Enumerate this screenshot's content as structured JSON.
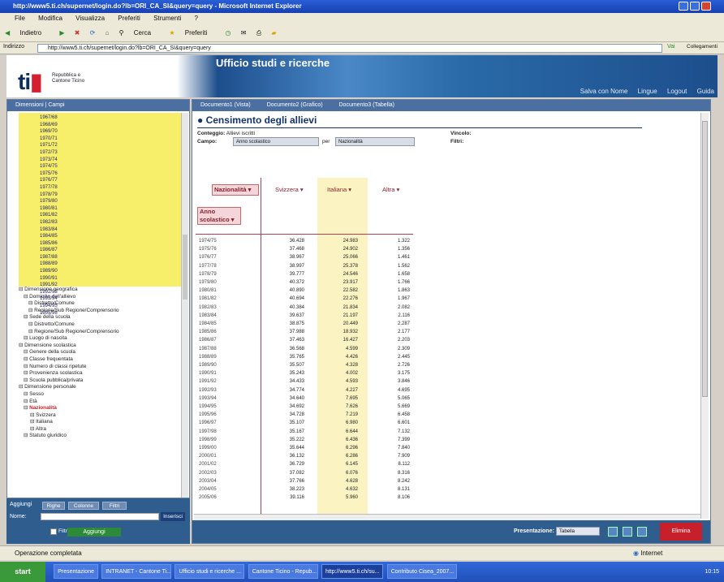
{
  "window": {
    "title": "http://www5.ti.ch/supernet/login.do?lb=ORI_CA_SI&query=query - Microsoft Internet Explorer"
  },
  "menu": [
    "File",
    "Modifica",
    "Visualizza",
    "Preferiti",
    "Strumenti",
    "?"
  ],
  "toolbar": {
    "back": "Indietro",
    "search": "Cerca",
    "favorites": "Preferiti"
  },
  "address": {
    "label": "Indirizzo",
    "url": "http://www5.ti.ch/supernet/login.do?lb=ORI_CA_SI&query=query",
    "go": "Vai",
    "links": "Collegamenti"
  },
  "banner": {
    "title": "Ufficio studi e ricerche",
    "canton1": "Repubblica e",
    "canton2": "Cantone Ticino",
    "links": [
      "Salva con Nome",
      "Lingue",
      "Logout",
      "Guida"
    ]
  },
  "left": {
    "tabs": "Dimensioni | Campi",
    "years": [
      "1967/68",
      "1968/69",
      "1969/70",
      "1970/71",
      "1971/72",
      "1972/73",
      "1973/74",
      "1974/75",
      "1975/76",
      "1976/77",
      "1977/78",
      "1978/79",
      "1979/80",
      "1980/81",
      "1981/82",
      "1982/83",
      "1983/84",
      "1984/85",
      "1985/86",
      "1986/87",
      "1987/88",
      "1988/89",
      "1989/90",
      "1990/91",
      "1991/92",
      "1992/93",
      "1993/94",
      "1994/95",
      "1995/96"
    ],
    "tree": [
      "Dimensione geografica",
      "Domicilio dell'allievo",
      "Distretto/Comune",
      "Regione/Sub Regione/Comprensorio",
      "Sede della scuola",
      "Distretto/Comune",
      "Regione/Sub Regione/Comprensorio",
      "Luogo di nascita",
      "Dimensione scolastica",
      "Genere della scuola",
      "Classe frequentata",
      "Numero di classi ripetute",
      "Provenienza scolastica",
      "Scuola pubblica/privata",
      "Dimensione personale",
      "Sesso",
      "Età",
      "Nazionalità",
      "Svizzera",
      "Italiana",
      "Altra",
      "Statuto giuridico"
    ],
    "bottom": {
      "title": "Aggiungi",
      "b1": "Righe",
      "b2": "Colonne",
      "b3": "Filtri",
      "name": "Nome:",
      "go": "Inserisci",
      "check": "Filtro",
      "add": "Aggiungi"
    }
  },
  "main": {
    "tabs": [
      "Documento1 (Vista)",
      "Documento2 (Grafico)",
      "Documento3 (Tabella)"
    ],
    "title": "Censimento degli allievi",
    "conteggio_label": "Conteggio:",
    "conteggio_val": "Allievi iscritti",
    "campo_label": "Campo:",
    "campo_val": "Anno scolastico",
    "per": "per",
    "campo2_val": "Nazionalità",
    "vincolo": "Vincolo:",
    "filtri": "Filtri:",
    "header": {
      "nat": "Nazionalità ▾",
      "c1": "Svizzera ▾",
      "c2": "Italiana ▾",
      "c3": "Altra ▾",
      "row": "Anno scolastico ▾"
    },
    "rows": [
      [
        "1974/75",
        "36.428",
        "24.983",
        "1.322"
      ],
      [
        "1975/76",
        "37.468",
        "24.902",
        "1.356"
      ],
      [
        "1976/77",
        "38.967",
        "25.066",
        "1.461"
      ],
      [
        "1977/78",
        "38.997",
        "25.378",
        "1.562"
      ],
      [
        "1978/79",
        "39.777",
        "24.546",
        "1.658"
      ],
      [
        "1979/80",
        "40.372",
        "23.917",
        "1.766"
      ],
      [
        "1980/81",
        "40.890",
        "22.582",
        "1.863"
      ],
      [
        "1981/82",
        "40.694",
        "22.276",
        "1.967"
      ],
      [
        "1982/83",
        "40.384",
        "21.834",
        "2.082"
      ],
      [
        "1983/84",
        "39.637",
        "21.197",
        "2.116"
      ],
      [
        "1984/85",
        "38.875",
        "20.449",
        "2.287"
      ],
      [
        "1985/86",
        "37.988",
        "18.932",
        "2.177"
      ],
      [
        "1986/87",
        "37.463",
        "16.427",
        "2.203"
      ],
      [
        "1987/88",
        "36.568",
        "4.599",
        "2.309"
      ],
      [
        "1988/89",
        "35.765",
        "4.426",
        "2.445"
      ],
      [
        "1989/90",
        "35.507",
        "4.328",
        "2.726"
      ],
      [
        "1990/91",
        "35.243",
        "4.002",
        "3.175"
      ],
      [
        "1991/92",
        "34.433",
        "4.593",
        "3.846"
      ],
      [
        "1992/93",
        "34.774",
        "4.227",
        "4.695"
      ],
      [
        "1993/94",
        "34.640",
        "7.695",
        "5.065"
      ],
      [
        "1994/95",
        "34.692",
        "7.626",
        "5.669"
      ],
      [
        "1995/96",
        "34.728",
        "7.219",
        "6.458"
      ],
      [
        "1996/97",
        "35.107",
        "6.980",
        "6.601"
      ],
      [
        "1997/98",
        "35.167",
        "6.644",
        "7.132"
      ],
      [
        "1998/99",
        "35.222",
        "6.436",
        "7.399"
      ],
      [
        "1999/00",
        "35.644",
        "6.296",
        "7.840"
      ],
      [
        "2000/01",
        "36.132",
        "6.286",
        "7.909"
      ],
      [
        "2001/02",
        "36.729",
        "6.145",
        "8.112"
      ],
      [
        "2002/03",
        "37.082",
        "6.076",
        "8.316"
      ],
      [
        "2003/04",
        "37.766",
        "4.628",
        "8.242"
      ],
      [
        "2004/05",
        "38.223",
        "4.632",
        "8.131"
      ],
      [
        "2005/06",
        "39.116",
        "5.960",
        "8.106"
      ]
    ],
    "bottom": {
      "label": "Presentazione:",
      "select": "Tabella",
      "red": "Elimina"
    }
  },
  "status": {
    "left": "Operazione completata",
    "zone": "Internet"
  },
  "taskbar": {
    "start": "start",
    "tasks": [
      "Presentazione",
      "INTRANET - Cantone Ti...",
      "Ufficio studi e ricerche ...",
      "Cantone Ticino - Repub...",
      "http://www5.ti.ch/su...",
      "Contributo Cisea_2007..."
    ],
    "clock": "10:15"
  }
}
